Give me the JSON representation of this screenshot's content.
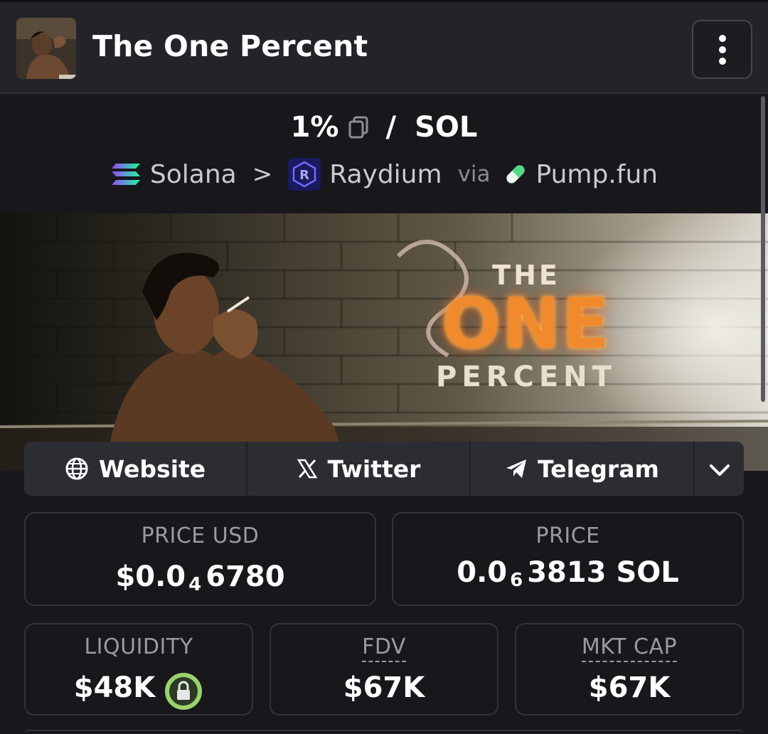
{
  "header": {
    "token_name": "The One Percent",
    "menu_icon": "kebab-menu-icon"
  },
  "pair": {
    "base": "1%",
    "separator": "/",
    "quote": "SOL",
    "copy_icon": "copy-icon"
  },
  "chain": {
    "network": "Solana",
    "dex": "Raydium",
    "via_label": "via",
    "launchpad": "Pump.fun"
  },
  "banner": {
    "line1": "THE",
    "line2": "ONE",
    "line3": "PERCENT"
  },
  "links": [
    {
      "label": "Website",
      "icon": "globe-icon"
    },
    {
      "label": "Twitter",
      "icon": "x-logo-icon"
    },
    {
      "label": "Telegram",
      "icon": "telegram-icon"
    },
    {
      "label": "",
      "icon": "chevron-down-icon"
    }
  ],
  "stats": {
    "price_usd": {
      "label": "PRICE USD",
      "prefix": "$0.0",
      "zeros": "4",
      "digits": "6780"
    },
    "price_sol": {
      "label": "PRICE",
      "prefix": "0.0",
      "zeros": "6",
      "digits": "3813 SOL"
    },
    "liquidity": {
      "label": "LIQUIDITY",
      "value": "$48K",
      "icon": "lock-icon"
    },
    "fdv": {
      "label": "FDV",
      "value": "$67K"
    },
    "mkt_cap": {
      "label": "MKT CAP",
      "value": "$67K"
    }
  },
  "colors": {
    "background": "#17171c",
    "header": "#232329",
    "card_border": "#33333a",
    "lock_ring": "#9bd36b",
    "label_gray": "#9a9aa3"
  }
}
